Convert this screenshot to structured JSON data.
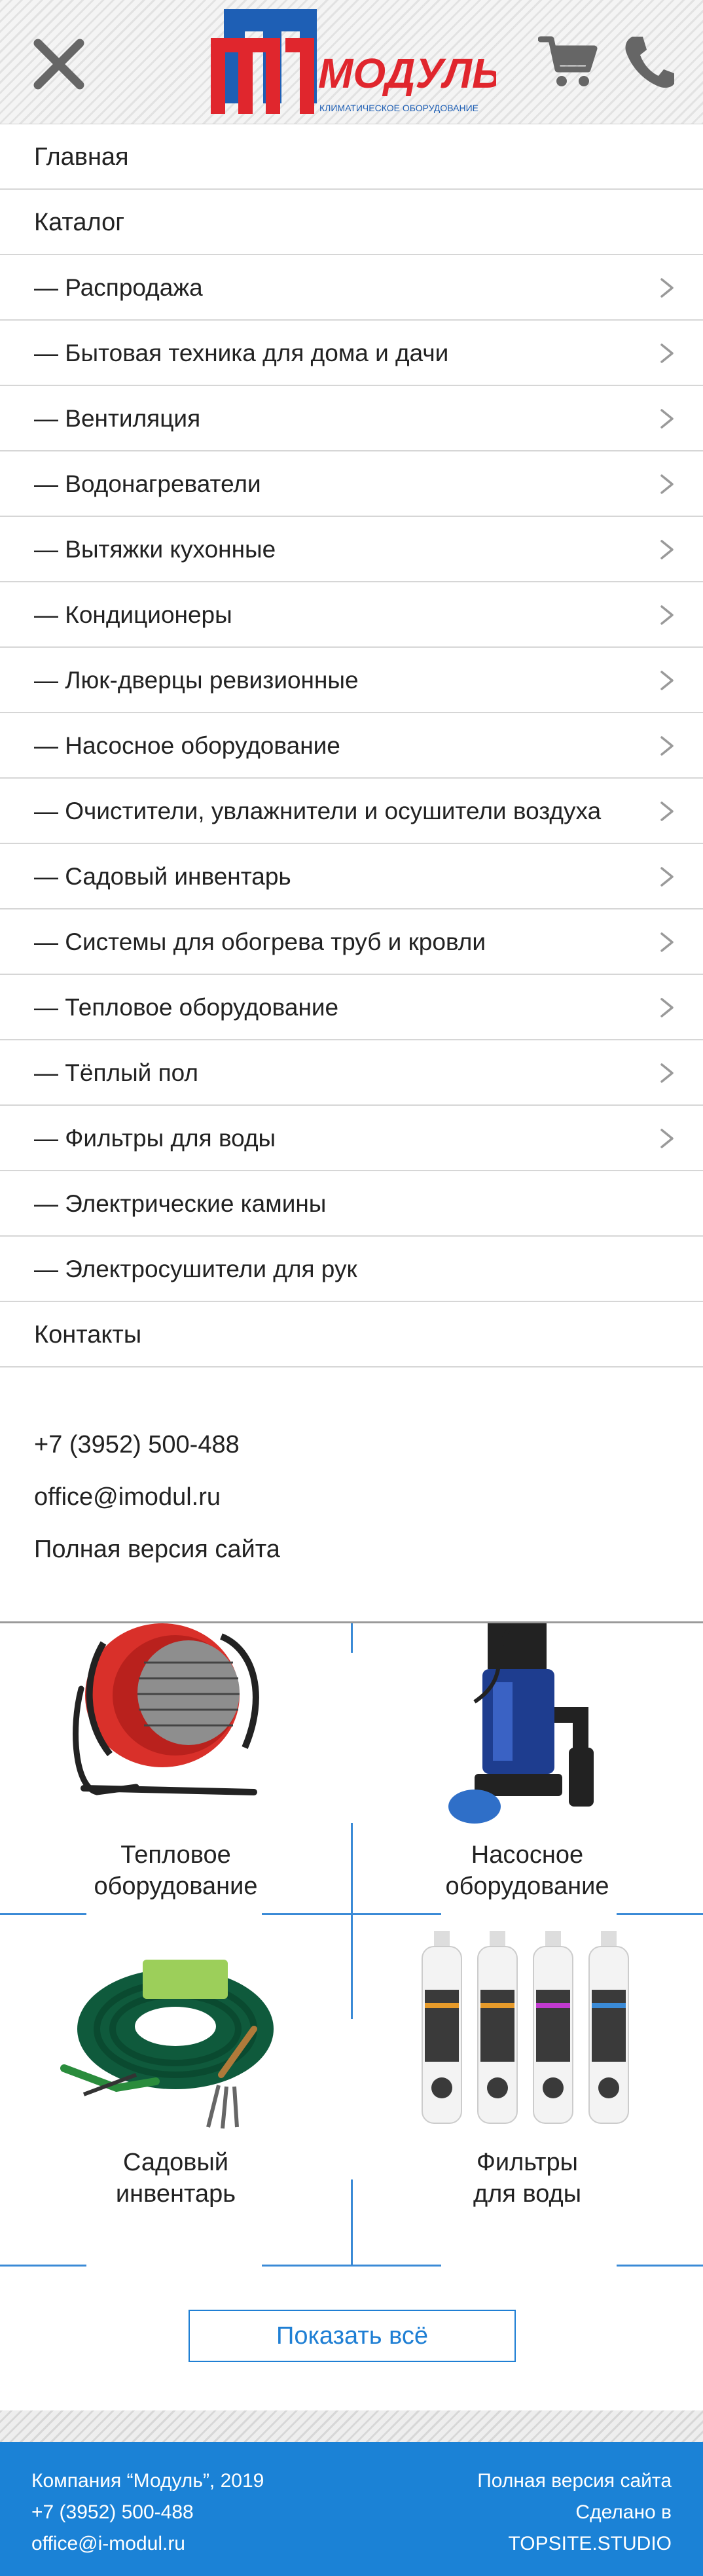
{
  "header": {
    "logo": {
      "brand": "МОДУЛЬ",
      "tagline": "КЛИМАТИЧЕСКОЕ ОБОРУДОВАНИЕ",
      "colors": {
        "red": "#e0262d",
        "blue": "#1e5fb5"
      }
    },
    "icons": {
      "close": "close-icon",
      "cart": "cart-icon",
      "phone": "phone-icon"
    }
  },
  "menu": {
    "home": "Главная",
    "catalog": "Каталог",
    "categories": [
      {
        "label": "— Распродажа",
        "has_submenu": true
      },
      {
        "label": "— Бытовая техника для дома и дачи",
        "has_submenu": true
      },
      {
        "label": "— Вентиляция",
        "has_submenu": true
      },
      {
        "label": "— Водонагреватели",
        "has_submenu": true
      },
      {
        "label": "— Вытяжки кухонные",
        "has_submenu": true
      },
      {
        "label": "— Кондиционеры",
        "has_submenu": true
      },
      {
        "label": "— Люк-дверцы ревизионные",
        "has_submenu": true
      },
      {
        "label": "— Насосное оборудование",
        "has_submenu": true
      },
      {
        "label": "— Очистители, увлажнители и осушители воздуха",
        "has_submenu": true
      },
      {
        "label": "— Садовый инвентарь",
        "has_submenu": true
      },
      {
        "label": "— Системы для обогрева труб и кровли",
        "has_submenu": true
      },
      {
        "label": "— Тепловое оборудование",
        "has_submenu": true
      },
      {
        "label": "— Тёплый пол",
        "has_submenu": true
      },
      {
        "label": "— Фильтры для воды",
        "has_submenu": true
      },
      {
        "label": "— Электрические камины",
        "has_submenu": false
      },
      {
        "label": "— Электросушители для рук",
        "has_submenu": false
      }
    ],
    "contacts": "Контакты"
  },
  "contacts": {
    "phone": "+7 (3952) 500-488",
    "email": "office@imodul.ru",
    "full_version": "Полная версия сайта"
  },
  "grid": {
    "items": [
      {
        "line1": "Тепловое",
        "line2": "оборудование",
        "image": "heat-gun-image"
      },
      {
        "line1": "Насосное",
        "line2": "оборудование",
        "image": "water-pump-image"
      },
      {
        "line1": "Садовый",
        "line2": "инвентарь",
        "image": "garden-hose-image"
      },
      {
        "line1": "Фильтры",
        "line2": "для воды",
        "image": "water-filter-image"
      }
    ],
    "accent": "#3a8ad6"
  },
  "show_all": "Показать всё",
  "footer": {
    "company": "Компания “Модуль”, 2019",
    "phone": "+7 (3952) 500-488",
    "email": "office@i-modul.ru",
    "full_version": "Полная версия сайта",
    "made_in": "Сделано в",
    "studio": "TOPSITE.STUDIO",
    "background": "#1b82d6"
  }
}
